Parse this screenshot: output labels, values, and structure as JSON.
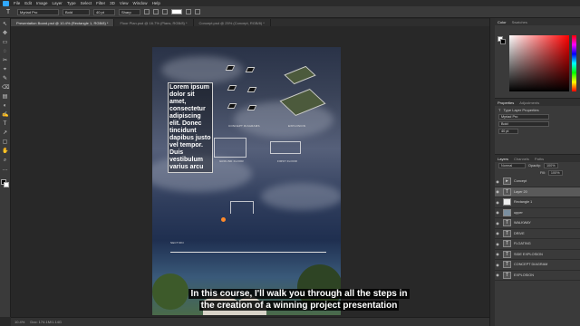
{
  "menu": {
    "items": [
      "File",
      "Edit",
      "Image",
      "Layer",
      "Type",
      "Select",
      "Filter",
      "3D",
      "View",
      "Window",
      "Help"
    ]
  },
  "options": {
    "tool_glyph": "T",
    "font_family": "Myriad Pro",
    "font_style": "Bold",
    "font_size": "40 pt",
    "antialias": "Sharp"
  },
  "tabs": [
    {
      "label": "Presentation Board.psd @ 10.4% (Rectangle 1, RGB/8) *",
      "active": true
    },
    {
      "label": "Floor Plan.psd @ 16.7% (Plans, RGB/8) *",
      "active": false
    },
    {
      "label": "Concept.psd @ 25% (Concept, RGB/8) *",
      "active": false
    }
  ],
  "toolbar": {
    "glyphs": [
      "↖",
      "✥",
      "▭",
      "◌",
      "✂",
      "⌖",
      "✎",
      "⌫",
      "▤",
      "◐",
      "✍",
      "T",
      "↗",
      "▢",
      "✋",
      "⌕",
      "…"
    ]
  },
  "artboard": {
    "text_block": "Lorem ipsum dolor sit amet, consectetur adipiscing elit. Donec tincidunt dapibus justo vel tempor. Duis vestibulum varius arcu",
    "captions": {
      "concept": "CONCEPT DIAGRAMS",
      "ground": "GROUND FLOOR",
      "first": "FIRST FLOOR",
      "section": "SECTION",
      "explosion": "EXPLOSION"
    }
  },
  "subtitle": {
    "line1": "In this course, I'll walk you through all the steps in",
    "line2": "the creation of a winning project presentation"
  },
  "status": {
    "zoom": "10.4%",
    "doc": "Doc: 174.1M/1.14G"
  },
  "panels": {
    "color_tabs": [
      "Color",
      "Swatches"
    ],
    "prop_tabs": [
      "Properties",
      "Adjustments"
    ],
    "props_title": "Type Layer Properties",
    "props_font": "Myriad Pro",
    "props_style": "Bold",
    "props_size": "40 pt",
    "layer_tabs": [
      "Layers",
      "Channels",
      "Paths"
    ],
    "blend_mode": "Normal",
    "opacity_label": "Opacity:",
    "opacity": "100%",
    "fill_label": "Fill:",
    "fill": "100%",
    "layers": [
      {
        "name": "Concept",
        "icon": "folder-icon",
        "glyph": "▸",
        "selected": false
      },
      {
        "name": "Layer 20",
        "icon": "text-layer-icon",
        "glyph": "T",
        "selected": true
      },
      {
        "name": "Rectangle 1",
        "icon": "shape-layer-icon",
        "glyph": "",
        "selected": false
      },
      {
        "name": "upper",
        "icon": "image-layer-icon",
        "glyph": "",
        "selected": false
      },
      {
        "name": "WALKWAY",
        "icon": "text-layer-icon",
        "glyph": "T",
        "selected": false
      },
      {
        "name": "DRIVE",
        "icon": "text-layer-icon",
        "glyph": "T",
        "selected": false
      },
      {
        "name": "FLOATING",
        "icon": "text-layer-icon",
        "glyph": "T",
        "selected": false
      },
      {
        "name": "SIDE EXPLOSION",
        "icon": "text-layer-icon",
        "glyph": "T",
        "selected": false
      },
      {
        "name": "CONCEPT DIAGRAM",
        "icon": "text-layer-icon",
        "glyph": "T",
        "selected": false
      },
      {
        "name": "EXPLOSION",
        "icon": "text-layer-icon",
        "glyph": "T",
        "selected": false
      }
    ]
  },
  "colors": {
    "accent_orange": "#ff8a2a",
    "ps_blue": "#31a8ff"
  }
}
